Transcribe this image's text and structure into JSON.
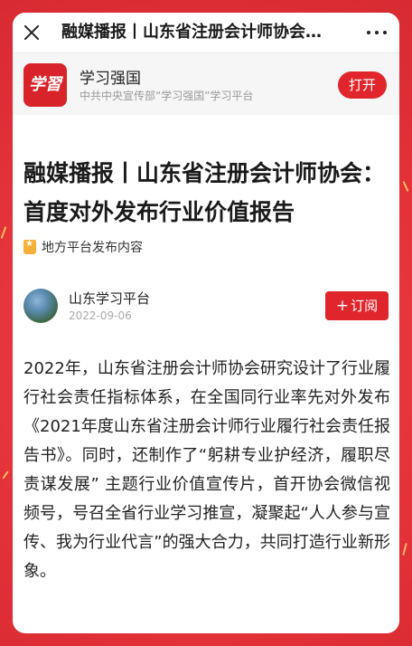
{
  "topbar": {
    "title": "融媒播报丨山东省注册会计师协会…",
    "close_icon": "close-icon",
    "more_icon": "more-dots-icon"
  },
  "app_banner": {
    "logo_text": "学習",
    "name": "学习强国",
    "subtitle": "中共中央宣传部“学习强国”学习平台",
    "open_label": "打开"
  },
  "article": {
    "title": "融媒播报丨山东省注册会计师协会：首度对外发布行业价值报告",
    "badge": "地方平台发布内容",
    "author": "山东学习平台",
    "date": "2022-09-06",
    "follow_plus": "+",
    "follow_label": "订阅",
    "body": "2022年，山东省注册会计师协会研究设计了行业履行社会责任指标体系，在全国同行业率先对外发布《2021年度山东省注册会计师行业履行社会责任报告书》。同时，还制作了“躬耕专业护经济，履职尽责谋发展” 主题行业价值宣传片，首开协会微信视频号，号召全省行业学习推宣，凝聚起“人人参与宣传、我为行业代言”的强大合力，共同打造行业新形象。"
  },
  "colors": {
    "frame_bg": "#e8393f",
    "accent": "#e0262c",
    "badge": "#f6b03a"
  }
}
